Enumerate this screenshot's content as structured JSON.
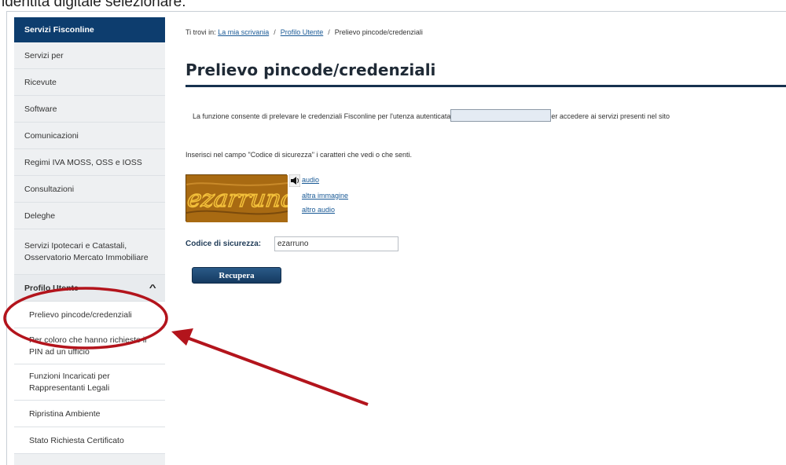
{
  "caption": "identità digitale selezionare:",
  "sidebar": {
    "header": "Servizi Fisconline",
    "items": [
      {
        "label": "Servizi per"
      },
      {
        "label": "Ricevute"
      },
      {
        "label": "Software"
      },
      {
        "label": "Comunicazioni"
      },
      {
        "label": "Regimi IVA MOSS, OSS e IOSS"
      },
      {
        "label": "Consultazioni"
      },
      {
        "label": "Deleghe"
      },
      {
        "label": "Servizi Ipotecari e Catastali, Osservatorio Mercato Immobiliare"
      }
    ],
    "group": {
      "label": "Profilo Utente",
      "chevron": "chevron-up-icon"
    },
    "sub_items": [
      {
        "label": "Prelievo pincode/credenziali"
      },
      {
        "label": "Per coloro che hanno richiesto il PIN ad un ufficio"
      },
      {
        "label": "Funzioni Incaricati per Rappresentanti Legali"
      },
      {
        "label": "Ripristina Ambiente"
      },
      {
        "label": "Stato Richiesta Certificato"
      }
    ]
  },
  "breadcrumb": {
    "prefix": "Ti trovi in:",
    "link1": "La mia scrivania",
    "link2": "Profilo Utente",
    "current": "Prelievo pincode/credenziali"
  },
  "main": {
    "title": "Prelievo pincode/credenziali",
    "intro_before": "La funzione consente di prelevare le credenziali Fisconline per l'utenza autenticata",
    "intro_after": "er accedere ai servizi presenti nel sito",
    "instructions": "Inserisci nel campo \"Codice di sicurezza\" i caratteri che vedi o che senti.",
    "captcha_text": "ezarruno",
    "links": {
      "audio": "audio",
      "other_image": "altra immagine",
      "other_audio": "altro audio"
    },
    "code_label": "Codice di sicurezza:",
    "code_value": "ezarruno",
    "button": "Recupera"
  },
  "colors": {
    "sidebar_header": "#0d3d6e",
    "title_rule": "#17324f",
    "link": "#1a5a96",
    "annotation": "#b3141c"
  },
  "icons": {
    "speaker": "speaker-icon"
  }
}
